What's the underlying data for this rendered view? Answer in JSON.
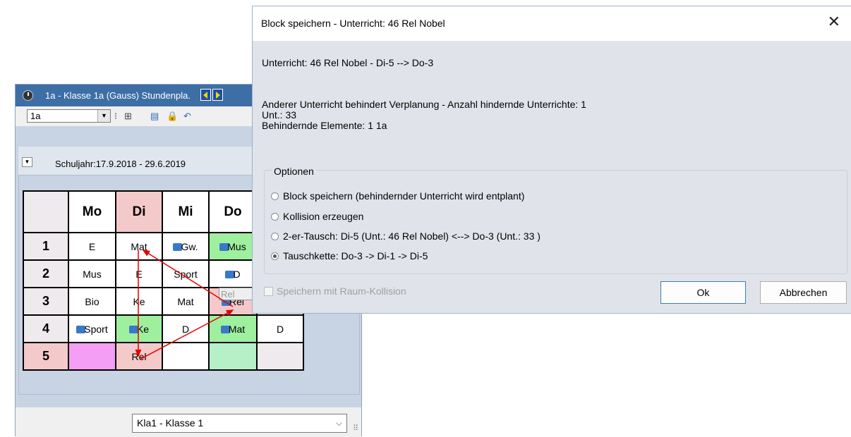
{
  "timetable_window": {
    "title": "1a - Klasse 1a (Gauss)  Stundenpla.",
    "class_select_value": "1a",
    "date_range": "Schuljahr:17.9.2018 - 29.6.2019",
    "footer_select_value": "Kla1 - Klasse 1",
    "drag_ghost_text": "Rel",
    "days": [
      "Mo",
      "Di",
      "Mi",
      "Do",
      ""
    ],
    "rows": [
      {
        "period": "1",
        "cells": [
          {
            "t": "E"
          },
          {
            "t": "Mat"
          },
          {
            "t": "Gw.",
            "icon": true
          },
          {
            "t": "Mus",
            "icon": true
          },
          {
            "t": ""
          }
        ]
      },
      {
        "period": "2",
        "cells": [
          {
            "t": "Mus"
          },
          {
            "t": "E"
          },
          {
            "t": "Sport"
          },
          {
            "t": "D",
            "icon": true
          },
          {
            "t": ""
          }
        ]
      },
      {
        "period": "3",
        "cells": [
          {
            "t": "Bio"
          },
          {
            "t": "Ke"
          },
          {
            "t": "Mat"
          },
          {
            "t": "Rel",
            "icon": true
          },
          {
            "t": ""
          }
        ]
      },
      {
        "period": "4",
        "cells": [
          {
            "t": "Sport",
            "icon": true
          },
          {
            "t": "Ke",
            "icon": true
          },
          {
            "t": "D"
          },
          {
            "t": "Mat",
            "icon": true
          },
          {
            "t": "D"
          }
        ]
      },
      {
        "period": "5",
        "cells": [
          {
            "t": ""
          },
          {
            "t": "Rel"
          },
          {
            "t": ""
          },
          {
            "t": ""
          },
          {
            "t": ""
          }
        ]
      }
    ],
    "colors": {
      "highlight_red": "#f4c9c9",
      "green": "#9ef09e",
      "light_green": "#b6f0c6",
      "pink": "#f59ef5",
      "grey_cell": "#eeeaee",
      "arrow": "#e60000"
    }
  },
  "dialog": {
    "title": "Block speichern - Unterricht: 46 Rel Nobel",
    "close_glyph": "✕",
    "lesson_line": "Unterricht: 46 Rel Nobel - Di-5 --> Do-3",
    "conflict_line": "Anderer Unterricht behindert Verplanung - Anzahl hindernde Unterrichte: 1",
    "unt_line": "Unt.: 33",
    "elements_line": "Behindernde Elemente: 1 1a",
    "options_legend": "Optionen",
    "options": [
      {
        "label": "Block speichern (behindernder Unterricht wird entplant)",
        "selected": false
      },
      {
        "label": "Kollision erzeugen",
        "selected": false
      },
      {
        "label": "2-er-Tausch: Di-5 (Unt.: 46 Rel Nobel) <--> Do-3 (Unt.: 33 )",
        "selected": false
      },
      {
        "label": "Tauschkette: Do-3 -> Di-1 -> Di-5",
        "selected": true
      }
    ],
    "room_collision_checkbox": "Speichern mit Raum-Kollision",
    "ok_label": "Ok",
    "cancel_label": "Abbrechen"
  }
}
